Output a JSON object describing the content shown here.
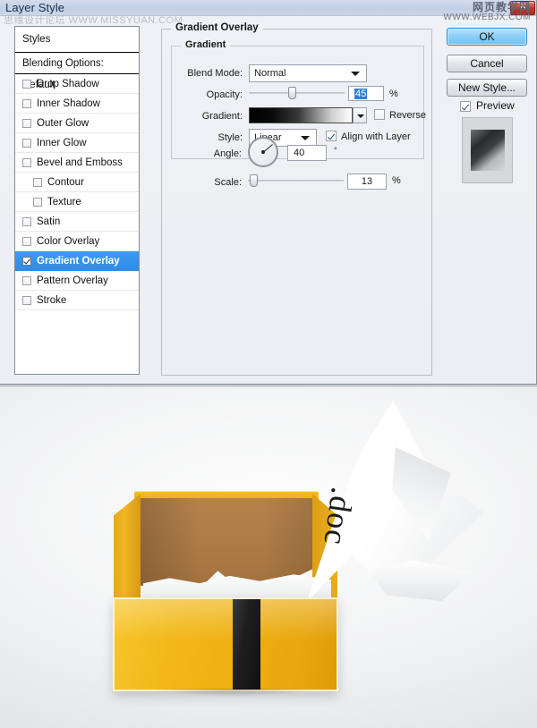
{
  "dialog": {
    "title": "Layer Style",
    "close_label": "✕",
    "watermark_left": "思缘设计论坛  WWW.MISSYUAN.COM",
    "watermark_right_cn": "网页教学网",
    "watermark_right_url": "WWW.WEBJX.COM"
  },
  "styles_panel": {
    "header": "Styles",
    "blending_options": "Blending Options: Default",
    "items": [
      {
        "label": "Drop Shadow",
        "checked": false,
        "indent": false,
        "selected": false
      },
      {
        "label": "Inner Shadow",
        "checked": false,
        "indent": false,
        "selected": false
      },
      {
        "label": "Outer Glow",
        "checked": false,
        "indent": false,
        "selected": false
      },
      {
        "label": "Inner Glow",
        "checked": false,
        "indent": false,
        "selected": false
      },
      {
        "label": "Bevel and Emboss",
        "checked": false,
        "indent": false,
        "selected": false
      },
      {
        "label": "Contour",
        "checked": false,
        "indent": true,
        "selected": false
      },
      {
        "label": "Texture",
        "checked": false,
        "indent": true,
        "selected": false
      },
      {
        "label": "Satin",
        "checked": false,
        "indent": false,
        "selected": false
      },
      {
        "label": "Color Overlay",
        "checked": false,
        "indent": false,
        "selected": false
      },
      {
        "label": "Gradient Overlay",
        "checked": true,
        "indent": false,
        "selected": true
      },
      {
        "label": "Pattern Overlay",
        "checked": false,
        "indent": false,
        "selected": false
      },
      {
        "label": "Stroke",
        "checked": false,
        "indent": false,
        "selected": false
      }
    ]
  },
  "panel": {
    "title": "Gradient Overlay",
    "section_title": "Gradient",
    "blend_mode": {
      "label": "Blend Mode:",
      "value": "Normal"
    },
    "opacity": {
      "label": "Opacity:",
      "value": "45",
      "unit": "%",
      "slider_percent": 45
    },
    "gradient": {
      "label": "Gradient:",
      "from": "#000000",
      "to": "#ffffff",
      "reverse_label": "Reverse",
      "reverse_checked": false
    },
    "style": {
      "label": "Style:",
      "value": "Linear",
      "align_label": "Align with Layer",
      "align_checked": true
    },
    "angle": {
      "label": "Angle:",
      "value": "40",
      "unit": "°"
    },
    "scale": {
      "label": "Scale:",
      "value": "13",
      "unit": "%",
      "slider_percent": 13
    }
  },
  "buttons": {
    "ok": "OK",
    "cancel": "Cancel",
    "new_style": "New Style...",
    "preview_label": "Preview",
    "preview_checked": true
  },
  "illustration": {
    "paper_label": ".doc",
    "box_color": "#f0b317",
    "cardboard_color": "#a97843",
    "strip_color": "#1e1e1e"
  }
}
